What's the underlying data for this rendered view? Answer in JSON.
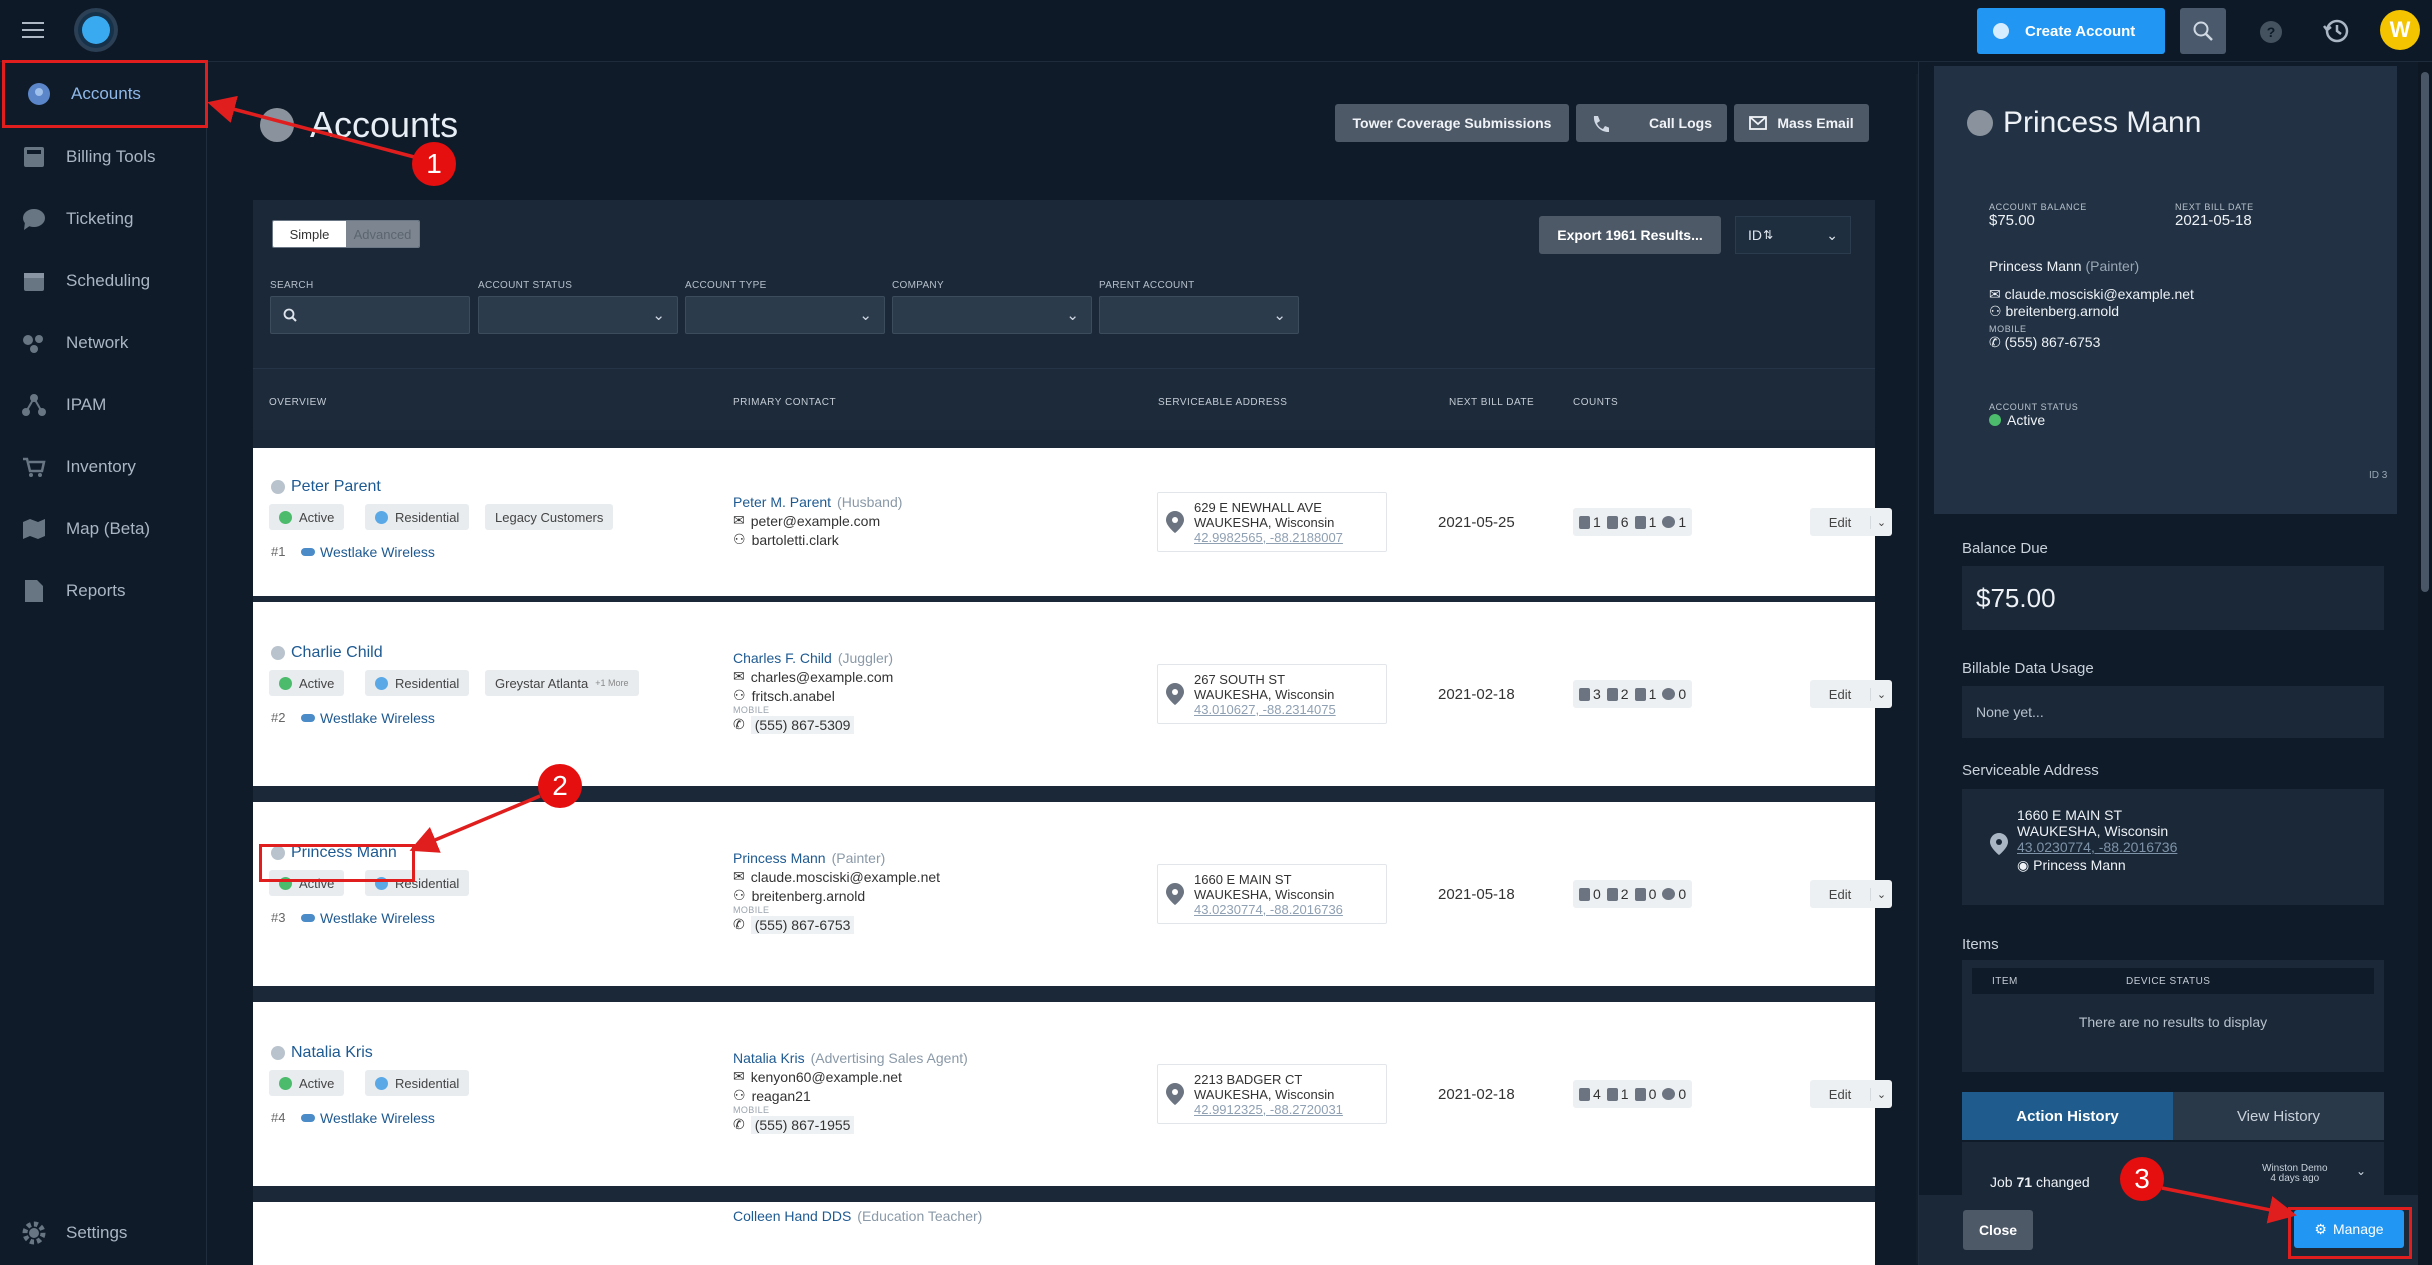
{
  "topbar": {
    "create_label": "Create Account",
    "avatar_letter": "W",
    "help_label": "?"
  },
  "sidebar": {
    "items": [
      {
        "label": "Accounts",
        "icon": "user-icon"
      },
      {
        "label": "Billing Tools",
        "icon": "calculator-icon"
      },
      {
        "label": "Ticketing",
        "icon": "chat-icon"
      },
      {
        "label": "Scheduling",
        "icon": "calendar-icon"
      },
      {
        "label": "Network",
        "icon": "network-icon"
      },
      {
        "label": "IPAM",
        "icon": "ipam-icon"
      },
      {
        "label": "Inventory",
        "icon": "cart-icon"
      },
      {
        "label": "Map (Beta)",
        "icon": "map-icon"
      },
      {
        "label": "Reports",
        "icon": "report-icon"
      },
      {
        "label": "Settings",
        "icon": "gear-icon"
      }
    ]
  },
  "page": {
    "title": "Accounts",
    "buttons": {
      "tower": "Tower Coverage Submissions",
      "call_logs": "Call Logs",
      "mass_email": "Mass Email"
    }
  },
  "filters": {
    "simple": "Simple",
    "advanced": "Advanced",
    "export": "Export 1961 Results...",
    "sort": "ID",
    "search": "SEARCH",
    "status": "ACCOUNT STATUS",
    "type": "ACCOUNT TYPE",
    "company": "COMPANY",
    "parent": "PARENT ACCOUNT"
  },
  "table": {
    "headers": {
      "overview": "OVERVIEW",
      "contact": "PRIMARY CONTACT",
      "address": "SERVICEABLE ADDRESS",
      "bill": "NEXT BILL DATE",
      "counts": "COUNTS"
    },
    "rows": [
      {
        "name": "Peter Parent",
        "status": "Active",
        "type": "Residential",
        "tag": "Legacy Customers",
        "tag_more": "",
        "id": "#1",
        "company": "Westlake Wireless",
        "contact": "Peter M. Parent",
        "role": "(Husband)",
        "email": "peter@example.com",
        "user": "bartoletti.clark",
        "mobile_label": "",
        "phone": "",
        "addr1": "629 E NEWHALL AVE",
        "addr2": "WAUKESHA, Wisconsin",
        "coords": "42.9982565, -88.2188007",
        "bill": "2021-05-25",
        "c1": "1",
        "c2": "6",
        "c3": "1",
        "c4": "1",
        "edit": "Edit"
      },
      {
        "name": "Charlie Child",
        "status": "Active",
        "type": "Residential",
        "tag": "Greystar Atlanta",
        "tag_more": "+1 More",
        "id": "#2",
        "company": "Westlake Wireless",
        "contact": "Charles F. Child",
        "role": "(Juggler)",
        "email": "charles@example.com",
        "user": "fritsch.anabel",
        "mobile_label": "MOBILE",
        "phone": "(555) 867-5309",
        "addr1": "267 SOUTH ST",
        "addr2": "WAUKESHA, Wisconsin",
        "coords": "43.010627, -88.2314075",
        "bill": "2021-02-18",
        "c1": "3",
        "c2": "2",
        "c3": "1",
        "c4": "0",
        "edit": "Edit"
      },
      {
        "name": "Princess Mann",
        "status": "Active",
        "type": "Residential",
        "tag": "",
        "tag_more": "",
        "id": "#3",
        "company": "Westlake Wireless",
        "contact": "Princess Mann",
        "role": "(Painter)",
        "email": "claude.mosciski@example.net",
        "user": "breitenberg.arnold",
        "mobile_label": "MOBILE",
        "phone": "(555) 867-6753",
        "addr1": "1660 E MAIN ST",
        "addr2": "WAUKESHA, Wisconsin",
        "coords": "43.0230774, -88.2016736",
        "bill": "2021-05-18",
        "c1": "0",
        "c2": "2",
        "c3": "0",
        "c4": "0",
        "edit": "Edit"
      },
      {
        "name": "Natalia Kris",
        "status": "Active",
        "type": "Residential",
        "tag": "",
        "tag_more": "",
        "id": "#4",
        "company": "Westlake Wireless",
        "contact": "Natalia Kris",
        "role": "(Advertising Sales Agent)",
        "email": "kenyon60@example.net",
        "user": "reagan21",
        "mobile_label": "MOBILE",
        "phone": "(555) 867-1955",
        "addr1": "2213 BADGER CT",
        "addr2": "WAUKESHA, Wisconsin",
        "coords": "42.9912325, -88.2720031",
        "bill": "2021-02-18",
        "c1": "4",
        "c2": "1",
        "c3": "0",
        "c4": "0",
        "edit": "Edit"
      }
    ],
    "partial": {
      "contact": "Colleen Hand DDS",
      "role": "(Education Teacher)"
    }
  },
  "panel": {
    "name": "Princess Mann",
    "balance_label": "ACCOUNT BALANCE",
    "balance": "$75.00",
    "next_bill_label": "NEXT BILL DATE",
    "next_bill": "2021-05-18",
    "contact": "Princess Mann",
    "role": "(Painter)",
    "email": "claude.mosciski@example.net",
    "user": "breitenberg.arnold",
    "mobile_label": "MOBILE",
    "phone": "(555) 867-6753",
    "status_label": "ACCOUNT STATUS",
    "status": "Active",
    "id": "ID 3",
    "balance_due_label": "Balance Due",
    "balance_due": "$75.00",
    "usage_label": "Billable Data Usage",
    "usage": "None yet...",
    "addr_label": "Serviceable Address",
    "addr1": "1660 E MAIN ST",
    "addr2": "WAUKESHA, Wisconsin",
    "coords": "43.0230774, -88.2016736",
    "addr_contact": "Princess Mann",
    "items_label": "Items",
    "item_col": "ITEM",
    "device_col": "DEVICE STATUS",
    "empty": "There are no results to display",
    "tab_action": "Action History",
    "tab_view": "View History",
    "job_prefix": "Job",
    "job_num": "71",
    "job_suffix": "changed",
    "job_user": "Winston Demo",
    "job_time": "4 days ago",
    "close": "Close",
    "manage": "Manage"
  },
  "callouts": [
    "1",
    "2",
    "3"
  ]
}
